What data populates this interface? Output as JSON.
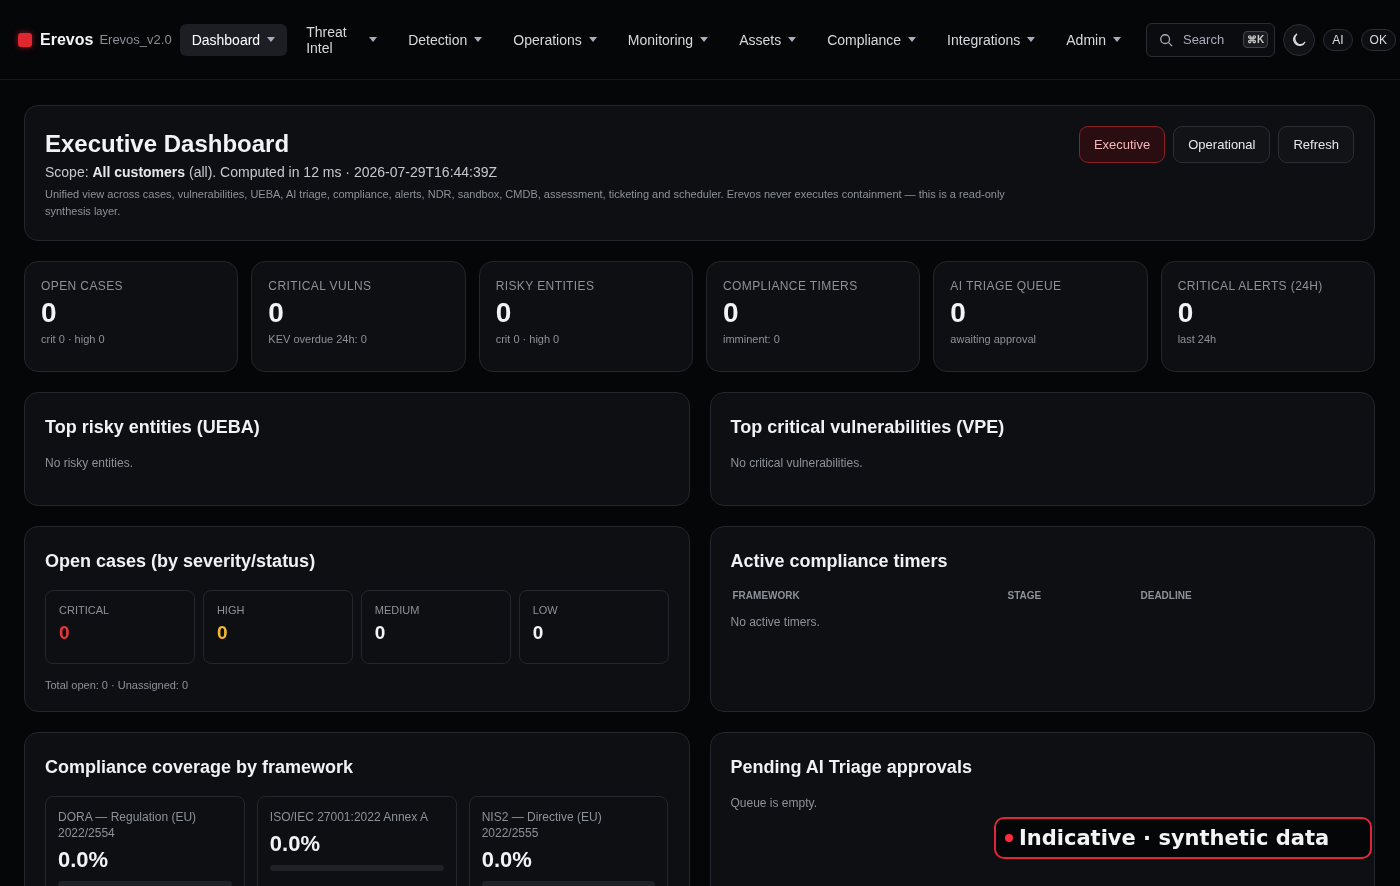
{
  "brand": {
    "name": "Erevos",
    "version": "Erevos_v2.0"
  },
  "nav": [
    {
      "label": "Dashboard",
      "selected": true
    },
    {
      "label": "Threat Intel",
      "selected": false
    },
    {
      "label": "Detection",
      "selected": false
    },
    {
      "label": "Operations",
      "selected": false
    },
    {
      "label": "Monitoring",
      "selected": false
    },
    {
      "label": "Assets",
      "selected": false
    },
    {
      "label": "Compliance",
      "selected": false
    },
    {
      "label": "Integrations",
      "selected": false
    },
    {
      "label": "Admin",
      "selected": false
    }
  ],
  "search": {
    "placeholder": "Search",
    "shortcut": "⌘K"
  },
  "top_buttons": [
    "AI",
    "OK"
  ],
  "header": {
    "title": "Executive Dashboard",
    "scope": "Scope: **All customers** (all). Computed in 12 ms · 2026-07-29T16:44:39Z",
    "description": "Unified view across cases, vulnerabilities, UEBA, AI triage, compliance, alerts, NDR, sandbox, CMDB, assessment, ticketing and scheduler. Erevos never executes containment — this is a read-only synthesis layer.",
    "views": [
      {
        "label": "Executive",
        "selected": true
      },
      {
        "label": "Operational",
        "selected": false
      }
    ],
    "refresh": "Refresh"
  },
  "kpis": [
    {
      "label": "OPEN CASES",
      "value": "0",
      "sub": "crit 0 · high 0"
    },
    {
      "label": "CRITICAL VULNS",
      "value": "0",
      "sub": "KEV overdue 24h: 0"
    },
    {
      "label": "RISKY ENTITIES",
      "value": "0",
      "sub": "crit 0 · high 0"
    },
    {
      "label": "COMPLIANCE TIMERS",
      "value": "0",
      "sub": "imminent: 0"
    },
    {
      "label": "AI TRIAGE QUEUE",
      "value": "0",
      "sub": "awaiting approval"
    },
    {
      "label": "CRITICAL ALERTS (24H)",
      "value": "0",
      "sub": "last 24h"
    }
  ],
  "risky_entities": {
    "title": "Top risky entities (UEBA)",
    "empty": "No risky entities."
  },
  "critical_vulns": {
    "title": "Top critical vulnerabilities (VPE)",
    "empty": "No critical vulnerabilities."
  },
  "open_cases": {
    "title": "Open cases (by severity/status)",
    "severities": [
      {
        "label": "CRITICAL",
        "value": "0",
        "color": "#e5383b"
      },
      {
        "label": "HIGH",
        "value": "0",
        "color": "#f5b82e"
      },
      {
        "label": "MEDIUM",
        "value": "0",
        "color": "#f2f4f7"
      },
      {
        "label": "LOW",
        "value": "0",
        "color": "#f2f4f7"
      }
    ],
    "footer": "Total open: 0 · Unassigned: 0"
  },
  "timers": {
    "title": "Active compliance timers",
    "columns": [
      "FRAMEWORK",
      "STAGE",
      "DEADLINE"
    ],
    "empty": "No active timers."
  },
  "coverage": {
    "title": "Compliance coverage by framework",
    "frameworks": [
      {
        "name": "DORA — Regulation (EU) 2022/2554",
        "value": "0.0%",
        "level": 0
      },
      {
        "name": "ISO/IEC 27001:2022 Annex A",
        "value": "0.0%",
        "level": 0
      },
      {
        "name": "NIS2 — Directive (EU) 2022/2555",
        "value": "0.0%",
        "level": 0
      }
    ]
  },
  "approvals": {
    "title": "Pending AI Triage approvals",
    "empty": "Queue is empty."
  },
  "badge": "Indicative · synthetic data"
}
